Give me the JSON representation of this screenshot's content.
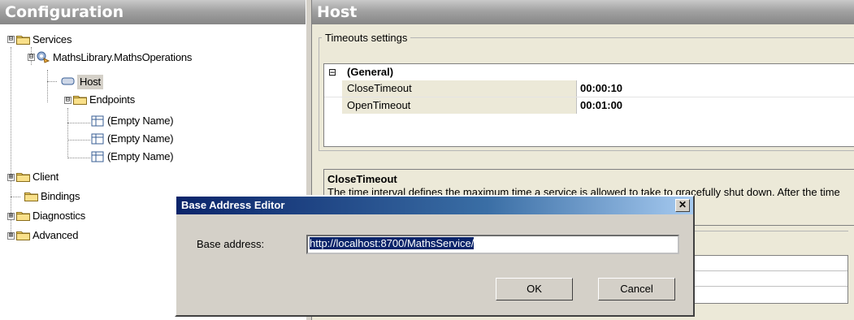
{
  "left_header": {
    "title": "Configuration"
  },
  "right_header": {
    "title": "Host"
  },
  "tree": {
    "services": "Services",
    "maths_ops": "MathsLibrary.MathsOperations",
    "host": "Host",
    "endpoints": "Endpoints",
    "endpoint_1": "(Empty Name)",
    "endpoint_2": "(Empty Name)",
    "endpoint_3": "(Empty Name)",
    "client": "Client",
    "bindings": "Bindings",
    "diagnostics": "Diagnostics",
    "advanced": "Advanced",
    "expander_open": "⊟",
    "expander_closed": "⊞"
  },
  "timeouts": {
    "group_title": "Timeouts settings",
    "category_expander": "⊟",
    "category": "(General)",
    "rows": [
      {
        "name": "CloseTimeout",
        "value": "00:00:10"
      },
      {
        "name": "OpenTimeout",
        "value": "00:01:00"
      }
    ],
    "description_title": "CloseTimeout",
    "description_text": "The time interval defines the maximum time a service is allowed to take to gracefully shut down. After the time limit runs out, the service is forced to shut down."
  },
  "dialog": {
    "title": "Base Address Editor",
    "close_glyph": "✕",
    "label": "Base address:",
    "value": "http://localhost:8700/MathsService/",
    "ok_label": "OK",
    "cancel_label": "Cancel"
  },
  "colors": {
    "title_bar": "#0a246a",
    "header_gray": "#a2a2a2",
    "panel_bg": "#ece9d8"
  }
}
